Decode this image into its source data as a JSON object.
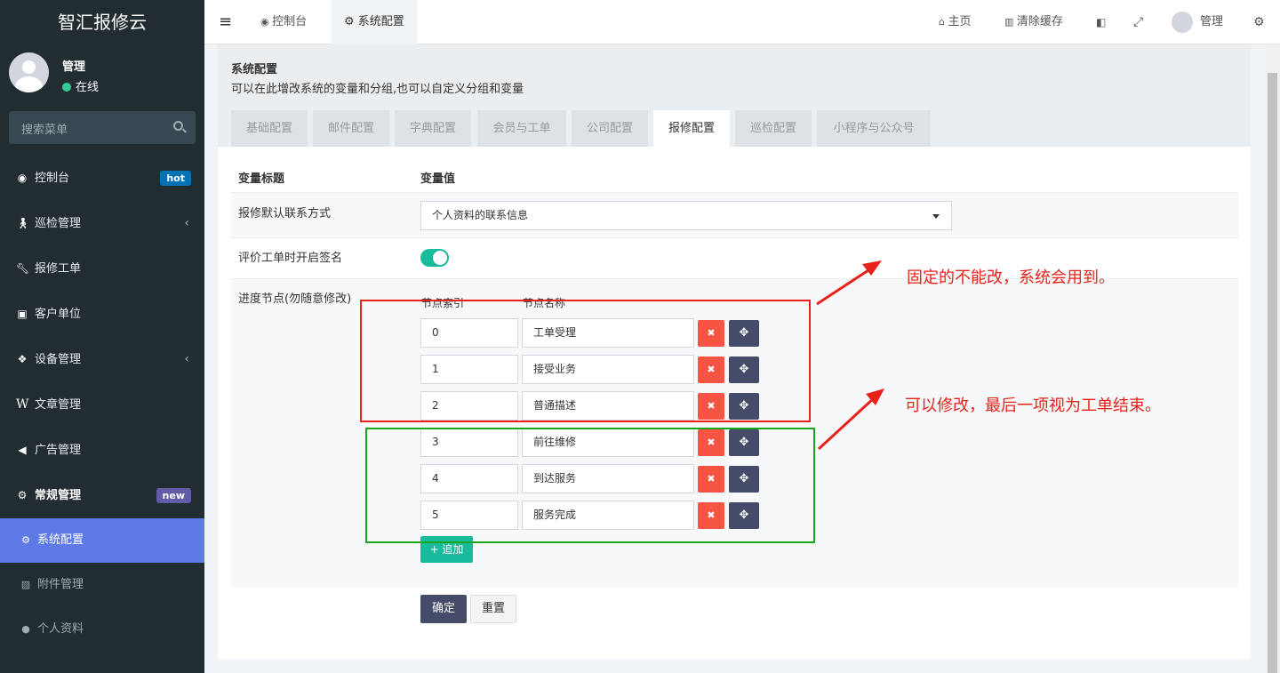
{
  "app": {
    "logo": "智汇报修云"
  },
  "user": {
    "name": "管理",
    "status": "在线"
  },
  "search": {
    "placeholder": "搜索菜单"
  },
  "menu": [
    {
      "label": "控制台",
      "icon": "dashboard-icon",
      "badge": "hot",
      "badge_color": "#0073b7"
    },
    {
      "label": "巡检管理",
      "icon": "walking-icon",
      "chevron": "‹"
    },
    {
      "label": "报修工单",
      "icon": "wrench-icon"
    },
    {
      "label": "客户单位",
      "icon": "contact-book-icon"
    },
    {
      "label": "设备管理",
      "icon": "cubes-icon",
      "chevron": "‹"
    },
    {
      "label": "文章管理",
      "icon": "wikipedia-w-icon"
    },
    {
      "label": "广告管理",
      "icon": "volume-icon"
    },
    {
      "label": "常规管理",
      "icon": "gears-icon",
      "badge": "new",
      "badge_color": "#605ca8"
    }
  ],
  "submenu": [
    {
      "label": "系统配置",
      "icon": "cog-icon"
    },
    {
      "label": "附件管理",
      "icon": "image-icon"
    },
    {
      "label": "个人资料",
      "icon": "user-icon"
    }
  ],
  "topbar": {
    "menu_toggle": "≡",
    "tabs": [
      {
        "label": "控制台"
      },
      {
        "label": "系统配置"
      }
    ],
    "home": "主页",
    "clear_cache": "清除缓存",
    "user": "管理"
  },
  "panel": {
    "title": "系统配置",
    "desc": "可以在此增改系统的变量和分组,也可以自定义分组和变量",
    "tabs": [
      "基础配置",
      "邮件配置",
      "字典配置",
      "会员与工单",
      "公司配置",
      "报修配置",
      "巡检配置",
      "小程序与公众号"
    ],
    "active_tab": "报修配置"
  },
  "form": {
    "col_title": "变量标题",
    "col_value": "变量值",
    "contact_label": "报修默认联系方式",
    "contact_value": "个人资料的联系信息",
    "sign_label": "评价工单时开启签名",
    "sign_enabled": true,
    "progress_label": "进度节点(勿随意修改)",
    "node_index_header": "节点索引",
    "node_name_header": "节点名称",
    "nodes": [
      {
        "index": "0",
        "name": "工单受理"
      },
      {
        "index": "1",
        "name": "接受业务"
      },
      {
        "index": "2",
        "name": "普通描述"
      },
      {
        "index": "3",
        "name": "前往维修"
      },
      {
        "index": "4",
        "name": "到达服务"
      },
      {
        "index": "5",
        "name": "服务完成"
      }
    ],
    "delete_glyph": "✖",
    "move_glyph": "✥",
    "add_label": "+ 追加",
    "submit_label": "确定",
    "reset_label": "重置"
  },
  "annotations": {
    "fixed": "固定的不能改，系统会用到。",
    "editable": "可以修改，最后一项视为工单结束。",
    "colors": {
      "red": "#e8221a",
      "green": "#1aa61a"
    }
  },
  "colors": {
    "sidebar": "#222d32",
    "active": "#5d7ae6",
    "primary": "#444c69",
    "success": "#18bc9c",
    "danger": "#f75444"
  }
}
